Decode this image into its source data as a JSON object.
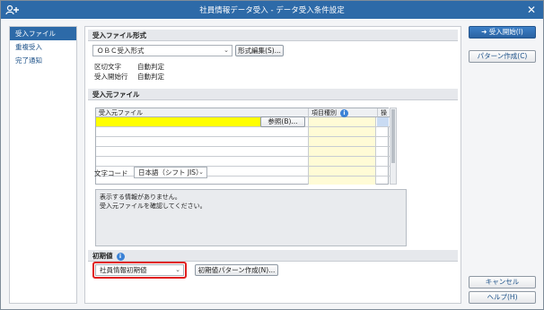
{
  "window": {
    "title": "社員情報データ受入 - データ受入条件設定",
    "close_glyph": "✕"
  },
  "sidebar": {
    "items": [
      {
        "label": "受入ファイル",
        "active": true
      },
      {
        "label": "重複受入",
        "active": false
      },
      {
        "label": "完了通知",
        "active": false
      }
    ]
  },
  "file_format": {
    "section_title": "受入ファイル形式",
    "format_select": "ＯＢＣ受入形式",
    "edit_button": "形式編集(S)...",
    "delimiter_label": "区切文字",
    "delimiter_value": "自動判定",
    "start_row_label": "受入開始行",
    "start_row_value": "自動判定"
  },
  "source_file": {
    "section_title": "受入元ファイル",
    "columns": [
      "受入元ファイル",
      "項目種別",
      "操作"
    ],
    "browse_button": "参照(B)...",
    "charcode_label": "文字コード",
    "charcode_select": "日本語（シフト JIS）",
    "message_lines": [
      "表示する情報がありません。",
      "受入元ファイルを確認してください。"
    ]
  },
  "initial_values": {
    "section_title": "初期値",
    "select_value": "社員情報初期値",
    "create_button": "初期値パターン作成(N)..."
  },
  "right_panel": {
    "start_button": "受入開始(I)",
    "pattern_button": "パターン作成(C)",
    "cancel_button": "キャンセル",
    "help_button": "ヘルプ(H)"
  },
  "colors": {
    "titlebar": "#2d6aa8",
    "highlight": "#e02020",
    "selected_cell": "#ffff00"
  }
}
